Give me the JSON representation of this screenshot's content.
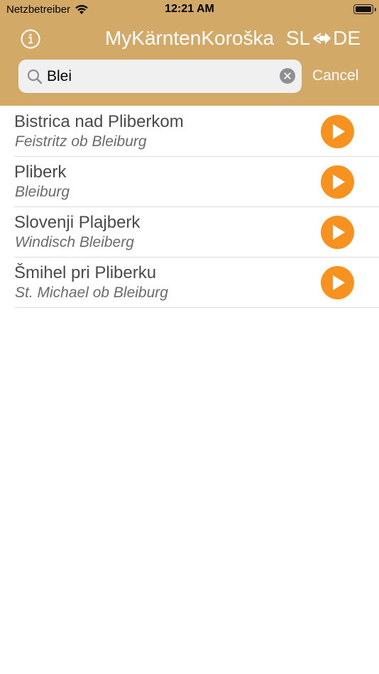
{
  "colors": {
    "header_background": "#d3a968",
    "accent_play": "#f7921e",
    "search_field_background": "#f0f0f0",
    "primary_text": "#4a4a4a",
    "secondary_text": "#6b6b6b"
  },
  "status_bar": {
    "carrier": "Netzbetreiber",
    "time": "12:21 AM",
    "wifi_icon": "wifi-icon",
    "battery_icon": "battery-icon"
  },
  "nav": {
    "info_icon": "info-icon",
    "title": "MyKärntenKoroška",
    "lang_from": "SL",
    "lang_to": "DE",
    "swap_icon": "swap-arrows-icon"
  },
  "search": {
    "value": "Blei",
    "icon": "search-icon",
    "clear_icon": "clear-icon",
    "cancel_label": "Cancel"
  },
  "results": [
    {
      "primary": "Bistrica nad Pliberkom",
      "secondary": "Feistritz ob Bleiburg"
    },
    {
      "primary": "Pliberk",
      "secondary": "Bleiburg"
    },
    {
      "primary": "Slovenji Plajberk",
      "secondary": "Windisch Bleiberg"
    },
    {
      "primary": "Šmihel pri Pliberku",
      "secondary": "St. Michael ob Bleiburg"
    }
  ]
}
